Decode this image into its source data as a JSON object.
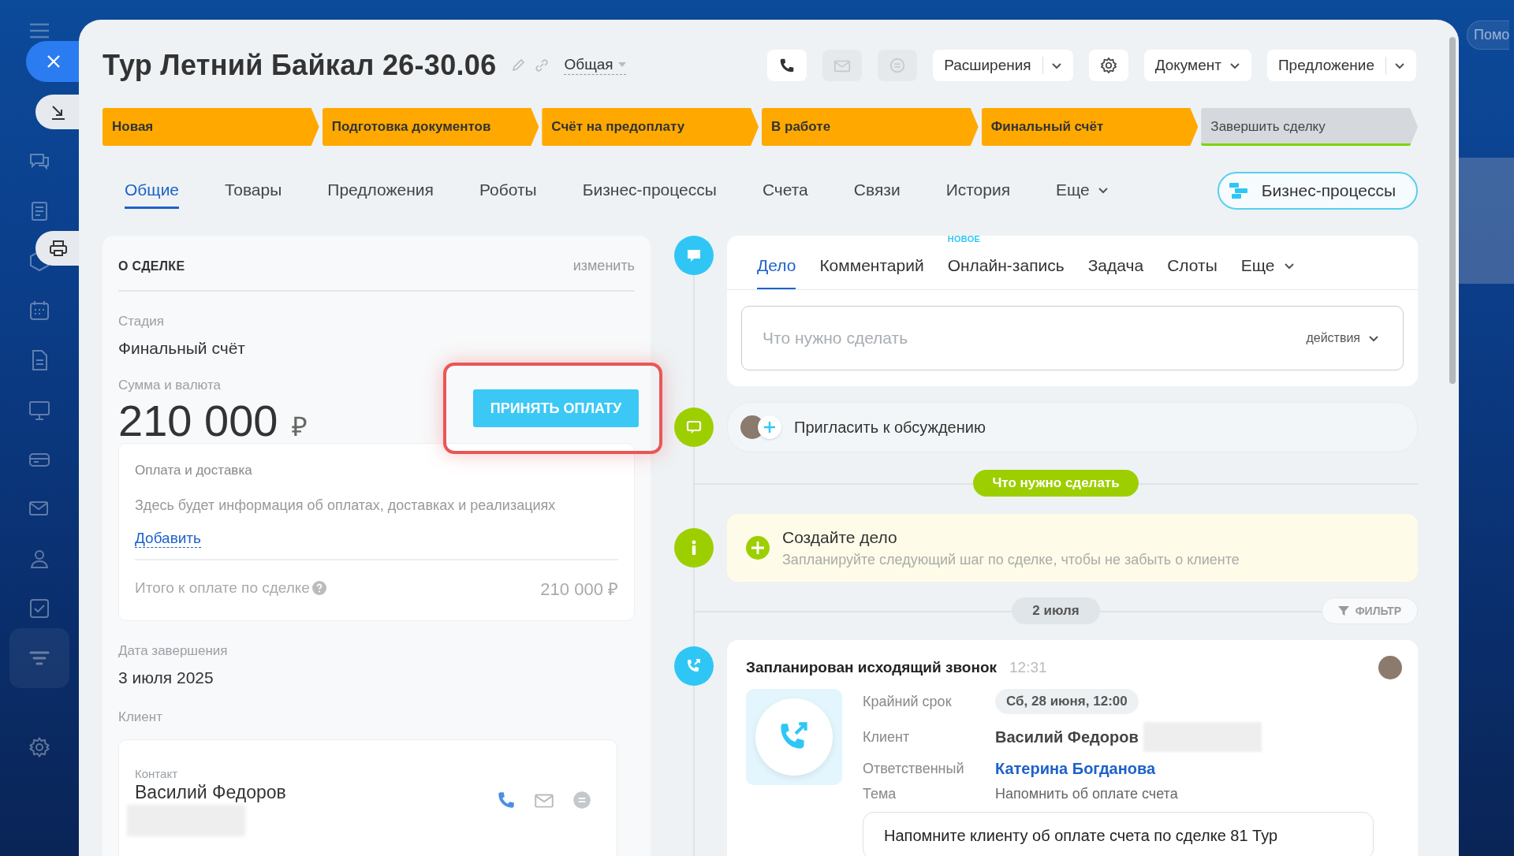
{
  "help": "Помо",
  "title": "Тур Летний Байкал 26-30.06",
  "category": "Общая",
  "toolbar": [
    {
      "kind": "phone",
      "disabled": false
    },
    {
      "kind": "mail",
      "disabled": true
    },
    {
      "kind": "chat",
      "disabled": true
    },
    {
      "kind": "split",
      "label": "Расширения"
    },
    {
      "kind": "settings"
    },
    {
      "kind": "dropdown",
      "label": "Документ"
    },
    {
      "kind": "split",
      "label": "Предложение"
    }
  ],
  "stages": [
    {
      "label": "Новая",
      "passed": true
    },
    {
      "label": "Подготовка документов",
      "passed": true
    },
    {
      "label": "Счёт на предоплату",
      "passed": true
    },
    {
      "label": "В работе",
      "passed": true
    },
    {
      "label": "Финальный счёт",
      "passed": true
    },
    {
      "label": "Завершить сделку",
      "passed": false
    }
  ],
  "tabs": [
    {
      "label": "Общие",
      "selected": true,
      "menu": false
    },
    {
      "label": "Товары",
      "selected": false,
      "menu": false
    },
    {
      "label": "Предложения",
      "selected": false,
      "menu": false
    },
    {
      "label": "Роботы",
      "selected": false,
      "menu": false
    },
    {
      "label": "Бизнес-процессы",
      "selected": false,
      "menu": false
    },
    {
      "label": "Счета",
      "selected": false,
      "menu": false
    },
    {
      "label": "Связи",
      "selected": false,
      "menu": false
    },
    {
      "label": "История",
      "selected": false,
      "menu": false
    },
    {
      "label": "Еще",
      "selected": false,
      "menu": true
    }
  ],
  "process_button": "Бизнес-процессы",
  "deal": {
    "heading": "О СДЕЛКЕ",
    "edit": "изменить",
    "stage_label": "Стадия",
    "stage_value": "Финальный счёт",
    "sum_label": "Сумма и валюта",
    "sum_value": "210 000",
    "currency": "₽",
    "pay_button": "ПРИНЯТЬ ОПЛАТУ",
    "highlighted": true,
    "payment": {
      "title": "Оплата и доставка",
      "info": "Здесь будет информация об оплатах, доставках и реализациях",
      "add_link": "Добавить",
      "total_label": "Итого к оплате по сделке",
      "total_value": "210 000 ₽"
    },
    "end_label": "Дата завершения",
    "end_value": "3 июля 2025",
    "client_label": "Клиент",
    "contact": {
      "label": "Контакт",
      "name": "Василий Федоров"
    }
  },
  "timeline": {
    "composer": {
      "tabs": [
        {
          "label": "Дело",
          "selected": true,
          "menu": false
        },
        {
          "label": "Комментарий",
          "selected": false,
          "menu": false
        },
        {
          "label": "Онлайн-запись",
          "selected": false,
          "menu": false,
          "badge": "НОВОЕ"
        },
        {
          "label": "Задача",
          "selected": false,
          "menu": false
        },
        {
          "label": "Слоты",
          "selected": false,
          "menu": false
        },
        {
          "label": "Еще",
          "selected": false,
          "menu": true
        }
      ],
      "placeholder": "Что нужно сделать",
      "actions": "действия"
    },
    "invite": "Пригласить к обсуждению",
    "todo_divider": "Что нужно сделать",
    "create": {
      "title": "Создайте дело",
      "subtitle": "Запланируйте следующий шаг по сделке, чтобы не забыть о клиенте"
    },
    "date_divider": "2 июля",
    "filter": "ФИЛЬТР",
    "call": {
      "title": "Запланирован исходящий звонок",
      "time": "12:31",
      "fields": [
        {
          "label": "Крайний срок",
          "value": "Сб, 28 июня, 12:00",
          "kind": "pill"
        },
        {
          "label": "Клиент",
          "value": "Василий Федоров",
          "kind": "contact"
        },
        {
          "label": "Ответственный",
          "value": "Катерина Богданова",
          "kind": "link"
        },
        {
          "label": "Тема",
          "value": "Напомнить об оплате счета",
          "kind": "plain"
        }
      ],
      "note": "Напомните клиенту об оплате счета по сделке 81 Тур"
    }
  }
}
